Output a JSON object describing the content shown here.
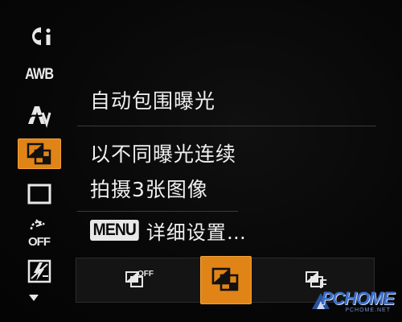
{
  "sidebar": {
    "items": [
      {
        "icon": "function-info-icon",
        "label": ""
      },
      {
        "icon": "white-balance-icon",
        "label": "AWB"
      },
      {
        "icon": "my-colors-icon",
        "label": ""
      },
      {
        "icon": "bracketing-icon",
        "label": "",
        "selected": true
      },
      {
        "icon": "single-frame-icon",
        "label": ""
      },
      {
        "icon": "self-timer-off-icon",
        "label": ""
      },
      {
        "icon": "flash-compensation-icon",
        "label": ""
      }
    ],
    "scroll_icon": "down-arrow-icon"
  },
  "panel": {
    "title": "自动包围曝光",
    "description_line1": "以不同曝光连续",
    "description_line2": "拍摄3张图像",
    "menu_badge": "MENU",
    "menu_text": "详细设置…"
  },
  "options": [
    {
      "icon": "bracketing-off-icon",
      "selected": false
    },
    {
      "icon": "auto-exposure-bracketing-icon",
      "selected": true
    },
    {
      "icon": "focus-bracketing-icon",
      "selected": false
    }
  ],
  "colors": {
    "accent": "#e18417",
    "background": "#060606",
    "text": "#f0f0f0"
  },
  "watermark": {
    "text": "PCHOME",
    "sub": "PCHOME.NET"
  }
}
